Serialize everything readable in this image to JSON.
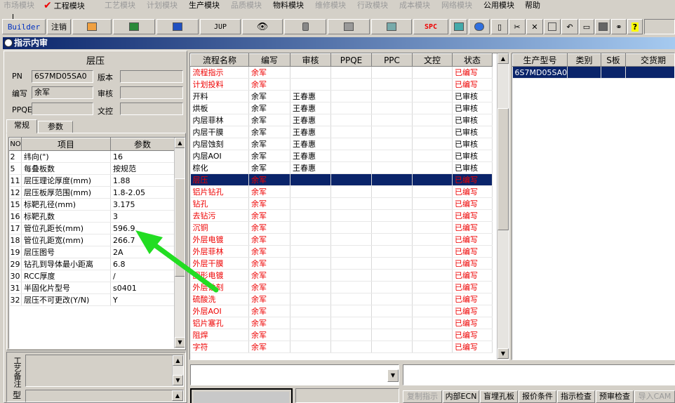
{
  "menu": [
    {
      "label": "市场模块",
      "enabled": false
    },
    {
      "label": "工程模块",
      "enabled": true,
      "checked": true
    },
    {
      "label": "工艺模块",
      "enabled": false
    },
    {
      "label": "计划模块",
      "enabled": false
    },
    {
      "label": "生产模块",
      "enabled": true
    },
    {
      "label": "品质模块",
      "enabled": false
    },
    {
      "label": "物料模块",
      "enabled": true
    },
    {
      "label": "维修模块",
      "enabled": false
    },
    {
      "label": "行政模块",
      "enabled": false
    },
    {
      "label": "成本模块",
      "enabled": false
    },
    {
      "label": "网络模块",
      "enabled": false
    },
    {
      "label": "公用模块",
      "enabled": true
    },
    {
      "label": "帮助",
      "enabled": true
    }
  ],
  "toolbar": {
    "builder": "Builder",
    "logout": "注销",
    "jup": "JUP",
    "spc": "SPC"
  },
  "window_title": "指示内审",
  "left": {
    "header": "层压",
    "pn_label": "PN",
    "pn_value": "6S7MD05SA0",
    "version_label": "版本",
    "version_value": "",
    "editor_label": "编写",
    "editor_value": "余军",
    "reviewer_label": "审核",
    "reviewer_value": "",
    "ppqe_label": "PPQE",
    "ppqe_value": "",
    "doccontrol_label": "文控",
    "doccontrol_value": "",
    "tabs": [
      "常规",
      "参数"
    ],
    "param_cols": [
      "NO",
      "项目",
      "参数"
    ],
    "params": [
      [
        "2",
        "纬向(\")",
        "16"
      ],
      [
        "5",
        "每叠板数",
        "按规范"
      ],
      [
        "11",
        "层压理论厚度(mm)",
        "1.88"
      ],
      [
        "12",
        "层压板厚范围(mm)",
        "1.8-2.05"
      ],
      [
        "15",
        "标靶孔径(mm)",
        "3.175"
      ],
      [
        "16",
        "标靶孔数",
        "3"
      ],
      [
        "17",
        "管位孔距长(mm)",
        "596.9"
      ],
      [
        "18",
        "管位孔距宽(mm)",
        "266.7"
      ],
      [
        "19",
        "层压图号",
        "2A"
      ],
      [
        "29",
        "钻孔到导体最小距离",
        "6.8"
      ],
      [
        "30",
        "RCC厚度",
        "/"
      ],
      [
        "31",
        "半固化片型号",
        "s0401"
      ],
      [
        "32",
        "层压不可更改(Y/N)",
        "Y"
      ]
    ],
    "notes_label": "工艺备注",
    "type_label": "型"
  },
  "flow": {
    "cols": [
      "流程名称",
      "编写",
      "审核",
      "PPQE",
      "PPC",
      "文控",
      "状态"
    ],
    "rows": [
      [
        "流程指示",
        "余军",
        "",
        "",
        "",
        "",
        "已编写"
      ],
      [
        "计划投料",
        "余军",
        "",
        "",
        "",
        "",
        "已编写"
      ],
      [
        "开料",
        "余军",
        "王春惠",
        "",
        "",
        "",
        "已审核"
      ],
      [
        "烘板",
        "余军",
        "王春惠",
        "",
        "",
        "",
        "已审核"
      ],
      [
        "内层菲林",
        "余军",
        "王春惠",
        "",
        "",
        "",
        "已审核"
      ],
      [
        "内层干膜",
        "余军",
        "王春惠",
        "",
        "",
        "",
        "已审核"
      ],
      [
        "内层蚀刻",
        "余军",
        "王春惠",
        "",
        "",
        "",
        "已审核"
      ],
      [
        "内层AOI",
        "余军",
        "王春惠",
        "",
        "",
        "",
        "已审核"
      ],
      [
        "棕化",
        "余军",
        "王春惠",
        "",
        "",
        "",
        "已审核"
      ],
      [
        "层压",
        "余军",
        "",
        "",
        "",
        "",
        "已编写"
      ],
      [
        "铝片钻孔",
        "余军",
        "",
        "",
        "",
        "",
        "已编写"
      ],
      [
        "钻孔",
        "余军",
        "",
        "",
        "",
        "",
        "已编写"
      ],
      [
        "去钻污",
        "余军",
        "",
        "",
        "",
        "",
        "已编写"
      ],
      [
        "沉铜",
        "余军",
        "",
        "",
        "",
        "",
        "已编写"
      ],
      [
        "外层电镀",
        "余军",
        "",
        "",
        "",
        "",
        "已编写"
      ],
      [
        "外层菲林",
        "余军",
        "",
        "",
        "",
        "",
        "已编写"
      ],
      [
        "外层干膜",
        "余军",
        "",
        "",
        "",
        "",
        "已编写"
      ],
      [
        "图形电镀",
        "余军",
        "",
        "",
        "",
        "",
        "已编写"
      ],
      [
        "外层蚀刻",
        "余军",
        "",
        "",
        "",
        "",
        "已编写"
      ],
      [
        "硫酸洗",
        "余军",
        "",
        "",
        "",
        "",
        "已编写"
      ],
      [
        "外层AOI",
        "余军",
        "",
        "",
        "",
        "",
        "已编写"
      ],
      [
        "铝片塞孔",
        "余军",
        "",
        "",
        "",
        "",
        "已编写"
      ],
      [
        "阻焊",
        "余军",
        "",
        "",
        "",
        "",
        "已编写"
      ],
      [
        "字符",
        "余军",
        "",
        "",
        "",
        "",
        "已编写"
      ]
    ]
  },
  "products": {
    "cols": [
      "生产型号",
      "类别",
      "S板",
      "交货期"
    ],
    "rows": [
      [
        "6S7MD05SA0",
        "",
        "",
        ""
      ]
    ]
  },
  "buttons": [
    "复制指示",
    "内部ECN",
    "盲埋孔板",
    "报价条件",
    "指示检查",
    "预审检查",
    "导入CAM"
  ],
  "colors": {
    "title_start": "#0a246a",
    "title_end": "#a6caf0",
    "selection": "#0a246a",
    "red_text": "#e00000",
    "arrow": "#22dd22"
  }
}
